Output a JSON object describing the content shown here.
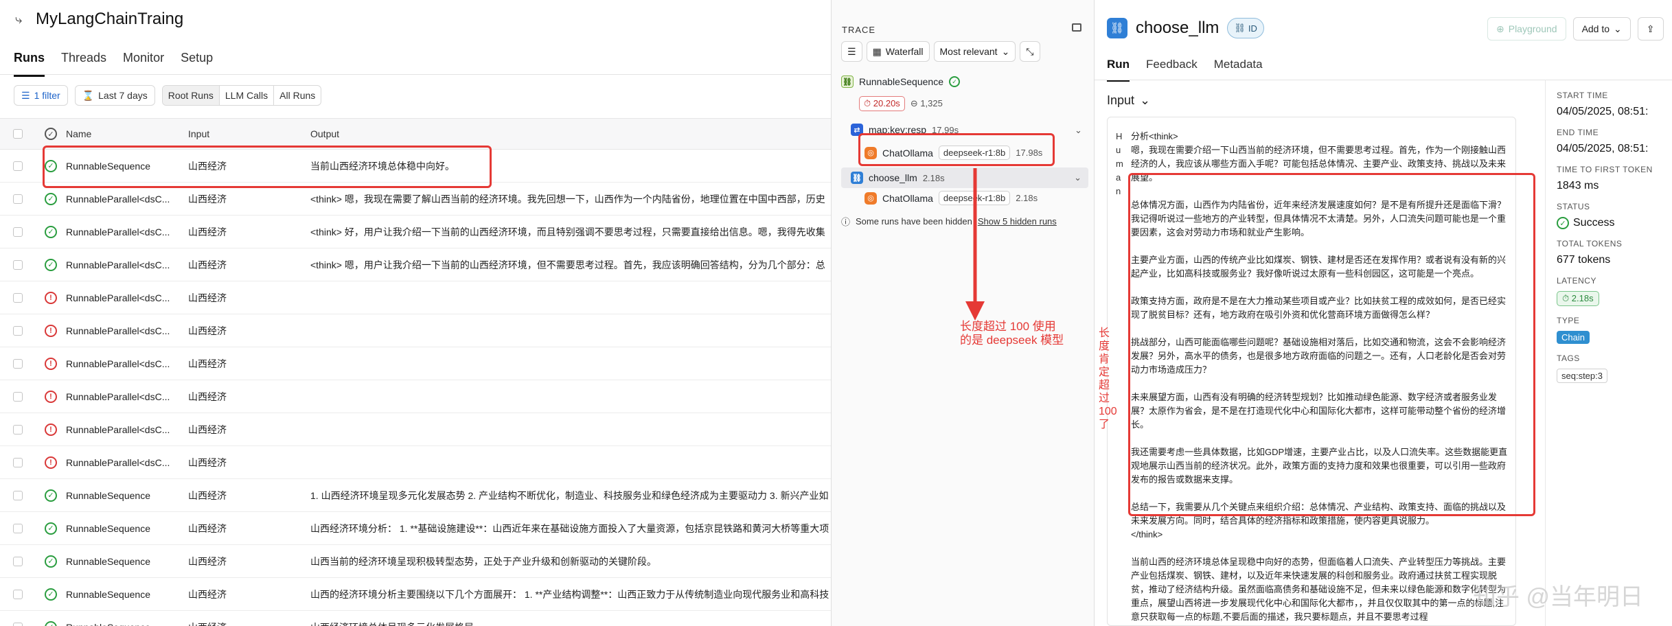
{
  "project": {
    "name": "MyLangChainTraing"
  },
  "nav": {
    "tabs": [
      "Runs",
      "Threads",
      "Monitor",
      "Setup"
    ]
  },
  "filters": {
    "filter_count": "1 filter",
    "date_range": "Last 7 days",
    "run_types": [
      "Root Runs",
      "LLM Calls",
      "All Runs"
    ]
  },
  "table": {
    "columns": [
      "Name",
      "Input",
      "Output"
    ],
    "rows": [
      {
        "status": "success",
        "name": "RunnableSequence",
        "input": "山西经济",
        "output": "当前山西经济环境总体稳中向好。"
      },
      {
        "status": "success",
        "name": "RunnableParallel<dsC...",
        "input": "山西经济",
        "output": "<think> 嗯，我现在需要了解山西当前的经济环境。我先回想一下，山西作为一个内陆省份，地理位置在中国中西部，历史"
      },
      {
        "status": "success",
        "name": "RunnableParallel<dsC...",
        "input": "山西经济",
        "output": "<think> 好，用户让我介绍一下当前的山西经济环境，而且特别强调不要思考过程，只需要直接给出信息。嗯，我得先收集"
      },
      {
        "status": "success",
        "name": "RunnableParallel<dsC...",
        "input": "山西经济",
        "output": "<think> 嗯，用户让我介绍一下当前的山西经济环境，但不需要思考过程。首先，我应该明确回答结构，分为几个部分：总"
      },
      {
        "status": "error",
        "name": "RunnableParallel<dsC...",
        "input": "山西经济",
        "output": ""
      },
      {
        "status": "error",
        "name": "RunnableParallel<dsC...",
        "input": "山西经济",
        "output": ""
      },
      {
        "status": "error",
        "name": "RunnableParallel<dsC...",
        "input": "山西经济",
        "output": ""
      },
      {
        "status": "error",
        "name": "RunnableParallel<dsC...",
        "input": "山西经济",
        "output": ""
      },
      {
        "status": "error",
        "name": "RunnableParallel<dsC...",
        "input": "山西经济",
        "output": ""
      },
      {
        "status": "error",
        "name": "RunnableParallel<dsC...",
        "input": "山西经济",
        "output": ""
      },
      {
        "status": "success",
        "name": "RunnableSequence",
        "input": "山西经济",
        "output": "1. 山西经济环境呈现多元化发展态势 2. 产业结构不断优化，制造业、科技服务业和绿色经济成为主要驱动力 3. 新兴产业如"
      },
      {
        "status": "success",
        "name": "RunnableSequence",
        "input": "山西经济",
        "output": "山西经济环境分析：  1. **基础设施建设**：山西近年来在基础设施方面投入了大量资源，包括京昆铁路和黄河大桥等重大项"
      },
      {
        "status": "success",
        "name": "RunnableSequence",
        "input": "山西经济",
        "output": "山西当前的经济环境呈现积极转型态势，正处于产业升级和创新驱动的关键阶段。"
      },
      {
        "status": "success",
        "name": "RunnableSequence",
        "input": "山西经济",
        "output": "山西的经济环境分析主要围绕以下几个方面展开：  1. **产业结构调整**：山西正致力于从传统制造业向现代服务业和高科技"
      },
      {
        "status": "success",
        "name": "RunnableSequence",
        "input": "山西经济",
        "output": "山西经济环境总体呈现多元化发展格局，..."
      }
    ]
  },
  "trace": {
    "header": "TRACE",
    "waterfall_label": "Waterfall",
    "sort_label": "Most relevant",
    "nodes": {
      "root": {
        "name": "RunnableSequence",
        "latency": "20.20s",
        "tokens": "1,325"
      },
      "map": {
        "name": "map:key:resp",
        "latency": "17.99s"
      },
      "llm1": {
        "name": "ChatOllama",
        "model": "deepseek-r1:8b",
        "latency": "17.98s"
      },
      "choose": {
        "name": "choose_llm",
        "latency": "2.18s"
      },
      "llm2": {
        "name": "ChatOllama",
        "model": "deepseek-r1:8b",
        "latency": "2.18s"
      }
    },
    "hidden_note": "Some runs have been hidden",
    "hidden_link": "Show 5 hidden runs"
  },
  "detail": {
    "title": "choose_llm",
    "id_label": "ID",
    "playground_label": "Playground",
    "add_to_label": "Add to",
    "tabs": [
      "Run",
      "Feedback",
      "Metadata"
    ],
    "input_label": "Input",
    "role_label": "Human",
    "input_paragraphs": [
      "分析<think>\n嗯，我现在需要介绍一下山西当前的经济环境，但不需要思考过程。首先，作为一个刚接触山西经济的人，我应该从哪些方面入手呢？可能包括总体情况、主要产业、政策支持、挑战以及未来展望。",
      "总体情况方面，山西作为内陆省份，近年来经济发展速度如何？是不是有所提升还是面临下滑？我记得听说过一些地方的产业转型，但具体情况不太清楚。另外，人口流失问题可能也是一个重要因素，这会对劳动力市场和就业产生影响。",
      "主要产业方面，山西的传统产业比如煤炭、钢铁、建材是否还在发挥作用？或者说有没有新的兴起产业，比如高科技或服务业？我好像听说过太原有一些科创园区，这可能是一个亮点。",
      "政策支持方面，政府是不是在大力推动某些项目或产业？比如扶贫工程的成效如何，是否已经实现了脱贫目标？还有，地方政府在吸引外资和优化营商环境方面做得怎么样？",
      "挑战部分，山西可能面临哪些问题呢？基础设施相对落后，比如交通和物流，这会不会影响经济发展？另外，高水平的债务，也是很多地方政府面临的问题之一。还有，人口老龄化是否会对劳动力市场造成压力？",
      "未来展望方面，山西有没有明确的经济转型规划？比如推动绿色能源、数字经济或者服务业发展？太原作为省会，是不是在打造现代化中心和国际化大都市，这样可能带动整个省份的经济增长。",
      "我还需要考虑一些具体数据，比如GDP增速，主要产业占比，以及人口流失率。这些数据能更直观地展示山西当前的经济状况。此外，政策方面的支持力度和效果也很重要，可以引用一些政府发布的报告或数据来支撑。",
      "总结一下，我需要从几个关键点来组织介绍：总体情况、产业结构、政策支持、面临的挑战以及未来发展方向。同时，结合具体的经济指标和政策措施，使内容更具说服力。\n</think>",
      "当前山西的经济环境总体呈现稳中向好的态势，但面临着人口流失、产业转型压力等挑战。主要产业包括煤炭、钢铁、建材，以及近年来快速发展的科创和服务业。政府通过扶贫工程实现脱贫，推动了经济结构升级。虽然面临高债务和基础设施不足，但未来以绿色能源和数字化转型为重点，展望山西将进一步发展现代化中心和国际化大都市，，并且仅仅取其中的第一点的标题,注意只获取每一点的标题,不要后面的描述，我只要标题点，并且不要思考过程"
    ],
    "side": {
      "start_time_label": "START TIME",
      "start_time": "04/05/2025, 08:51:",
      "end_time_label": "END TIME",
      "end_time": "04/05/2025, 08:51:",
      "ttft_label": "TIME TO FIRST TOKEN",
      "ttft": "1843 ms",
      "status_label": "STATUS",
      "status": "Success",
      "total_tokens_label": "TOTAL TOKENS",
      "total_tokens": "677 tokens",
      "latency_label": "LATENCY",
      "latency": "2.18s",
      "type_label": "TYPE",
      "type": "Chain",
      "tags_label": "TAGS",
      "tag": "seq:step:3"
    }
  },
  "annotations": {
    "arrow_note": "长度超过 100 使用\n的是 deepseek 模型",
    "side_note": "长\n度\n肯\n定\n超\n过\n100\n了"
  },
  "watermark": "知乎 @当年明日",
  "colors": {
    "annotation": "#e53935",
    "success": "#2a9d3f",
    "error": "#d93838",
    "accent": "#2f7fd6"
  }
}
